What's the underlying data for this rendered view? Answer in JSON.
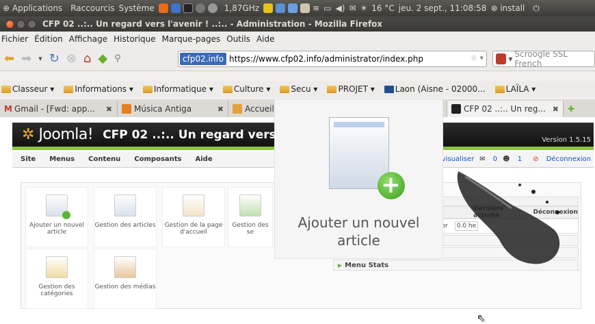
{
  "system_panel": {
    "applications": "Applications",
    "shortcuts": "Raccourcis",
    "system": "Système",
    "cpu_freq": "1,87GHz",
    "weather": "16 °C",
    "datetime": "jeu. 2 sept., 11:08:58",
    "install": "install"
  },
  "window": {
    "title": "CFP 02 ..:.. Un regard vers l'avenir ! ..:.. - Administration - Mozilla Firefox"
  },
  "menubar": {
    "items": [
      "Fichier",
      "Édition",
      "Affichage",
      "Historique",
      "Marque-pages",
      "Outils",
      "Aide"
    ]
  },
  "navbar": {
    "site_identity": "cfp02.info",
    "url": "https://www.cfp02.info/administrator/index.php",
    "search_placeholder": "Scroogle SSL French"
  },
  "bookmarks": {
    "items": [
      "Classeur ▾",
      "Informations ▾",
      "Informatique ▾",
      "Culture ▾",
      "Secu ▾",
      "PROJET ▾",
      "Laon (Aisne - 02000...",
      "LAÏLA ▾"
    ]
  },
  "tabs": {
    "items": [
      {
        "label": "Gmail - [Fwd: app..."
      },
      {
        "label": "Música Antiga"
      },
      {
        "label": "Accueil"
      },
      {
        "label": "CFP 02 ..:.. Un reg..."
      }
    ],
    "close_glyph": "✖"
  },
  "joomla": {
    "logo_text": "Joomla!",
    "site_title": "CFP 02 ..:.. Un regard vers",
    "version": "Version 1.5.15",
    "menu": [
      "Site",
      "Menus",
      "Contenu",
      "Composants",
      "Aide"
    ],
    "status": {
      "preview": "Prévisualiser",
      "messages": "0",
      "users": "1",
      "logout": "Déconnexion"
    },
    "icons": [
      {
        "label": "Ajouter un nouvel article"
      },
      {
        "label": "Gestion des articles"
      },
      {
        "label": "Gestion de la page d'accueil"
      },
      {
        "label": "Gestion des se"
      },
      {
        "label": "Gestion des catégories"
      },
      {
        "label": "Gestion des médias"
      }
    ],
    "table": {
      "col_last_activity": "Dernière activité",
      "col_logout": "Déconnexion",
      "row_role": "tor",
      "row_value": "0.0 he"
    },
    "menu_stats": "Menu Stats"
  },
  "tooltip": {
    "label": "Ajouter un nouvel article"
  }
}
